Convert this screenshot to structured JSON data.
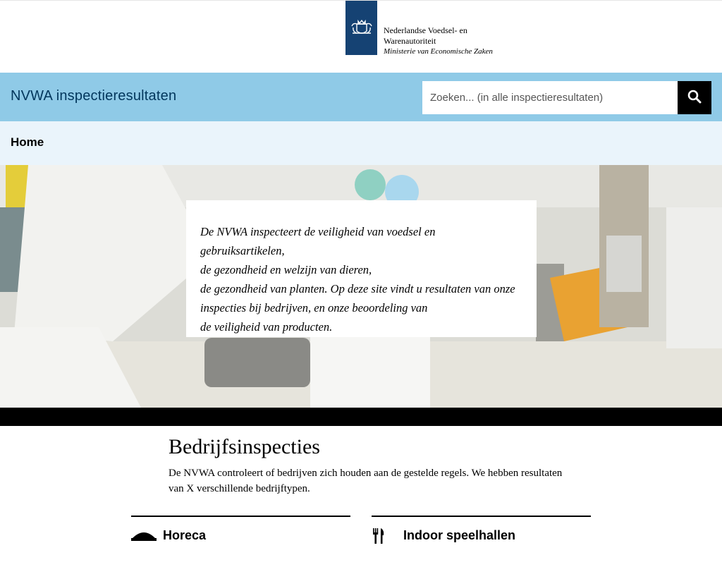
{
  "masthead": {
    "org_line1": "Nederlandse Voedsel- en",
    "org_line2": "Warenautoriteit",
    "ministry": "Ministerie van Economische Zaken",
    "logo_color": "#154273"
  },
  "header": {
    "site_title": "NVWA inspectieresultaten",
    "search_placeholder": "Zoeken... (in alle inspectieresultaten)",
    "search_button_icon": "search-icon",
    "bar_color": "#8fcae7"
  },
  "nav": {
    "home_label": "Home"
  },
  "hero": {
    "lines": [
      "De NVWA inspecteert de veiligheid van voedsel en gebruiksartikelen,",
      "de gezondheid en welzijn van dieren,",
      "de gezondheid van planten. Op deze site vindt u resultaten van onze",
      "inspecties bij bedrijven, en onze beoordeling van",
      "de veiligheid van producten."
    ]
  },
  "section": {
    "title": "Bedrijfsinspecties",
    "description": "De NVWA controleert of bedrijven zich houden aan de gestelde regels. We hebben resultaten van X verschillende bedrijftypen.",
    "cards": [
      {
        "label": "Horeca",
        "icon": "dish-icon"
      },
      {
        "label": "Indoor speelhallen",
        "icon": "cutlery-icon"
      }
    ]
  }
}
